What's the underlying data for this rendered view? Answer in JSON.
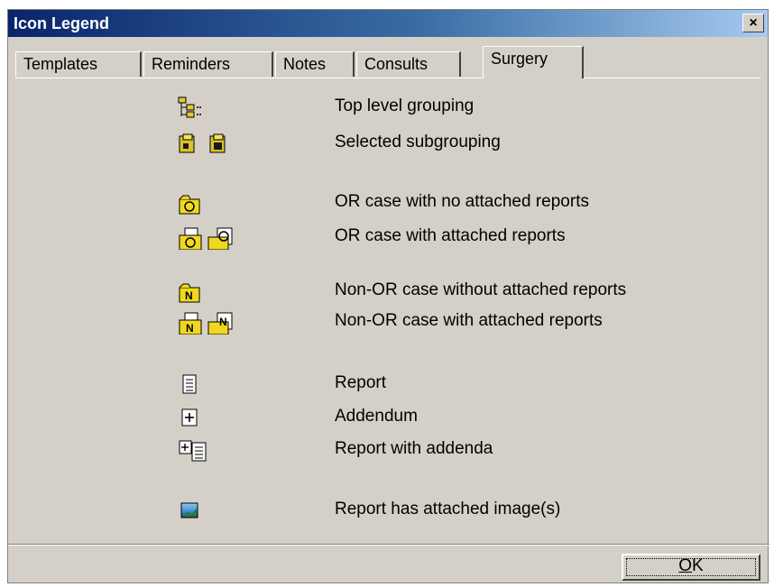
{
  "window": {
    "title": "Icon Legend",
    "close_label": "×"
  },
  "tabs": [
    {
      "label": "Templates"
    },
    {
      "label": "Reminders"
    },
    {
      "label": "Notes"
    },
    {
      "label": "Consults"
    },
    {
      "label": "Surgery",
      "active": true
    }
  ],
  "legend": [
    {
      "icon": "tree-grouping-icon",
      "label": "Top level grouping"
    },
    {
      "icon": "selected-subgrouping-icons",
      "label": "Selected subgrouping"
    },
    {
      "icon": "or-case-icon",
      "label": "OR case with no attached reports"
    },
    {
      "icon": "or-case-with-reports-icons",
      "label": "OR case with attached reports"
    },
    {
      "icon": "non-or-case-icon",
      "label": "Non-OR case without attached reports"
    },
    {
      "icon": "non-or-case-with-reports-icons",
      "label": "Non-OR case with attached reports"
    },
    {
      "icon": "report-icon",
      "label": "Report"
    },
    {
      "icon": "addendum-icon",
      "label": "Addendum"
    },
    {
      "icon": "report-with-addenda-icon",
      "label": "Report with addenda"
    },
    {
      "icon": "attached-image-icon",
      "label": "Report has attached image(s)"
    }
  ],
  "footer": {
    "ok_mnemonic": "O",
    "ok_rest": "K"
  }
}
